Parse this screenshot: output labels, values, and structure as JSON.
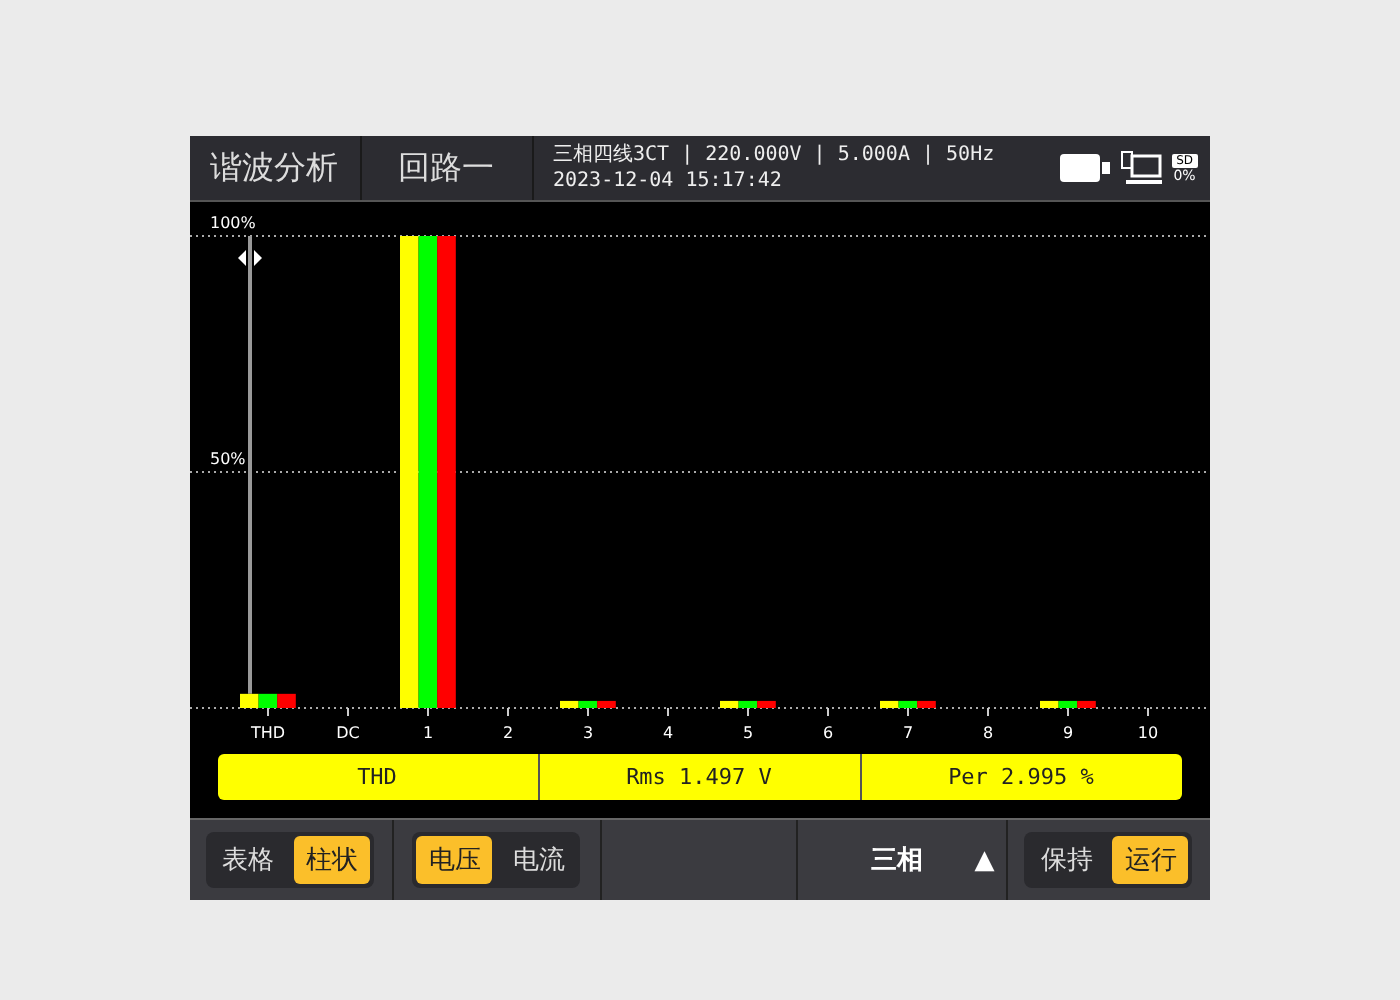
{
  "header": {
    "title": "谐波分析",
    "loop": "回路一",
    "info": "三相四线3CT | 220.000V | 5.000A | 50Hz",
    "datetime": "2023-12-04 15:17:42",
    "sd_label": "SD",
    "storage": "0%"
  },
  "chart": {
    "chart_data": {
      "type": "bar",
      "categories": [
        "THD",
        "DC",
        "1",
        "2",
        "3",
        "4",
        "5",
        "6",
        "7",
        "8",
        "9",
        "10"
      ],
      "ylim": [
        0,
        100
      ],
      "yticks": [
        {
          "value": 50,
          "label": "50%"
        },
        {
          "value": 100,
          "label": "100%"
        }
      ],
      "series": [
        {
          "color": "#ffff00",
          "values": [
            3,
            0,
            100,
            0,
            1.5,
            0,
            1.5,
            0,
            1.5,
            0,
            1.5,
            0
          ]
        },
        {
          "color": "#00ff00",
          "values": [
            3,
            0,
            100,
            0,
            1.5,
            0,
            1.5,
            0,
            1.5,
            0,
            1.5,
            0
          ]
        },
        {
          "color": "#ff0000",
          "values": [
            3,
            0,
            100,
            0,
            1.5,
            0,
            1.5,
            0,
            1.5,
            0,
            1.5,
            0
          ]
        }
      ]
    }
  },
  "info_bar": [
    "THD",
    "Rms 1.497 V",
    "Per 2.995 %"
  ],
  "toolbar": {
    "view_tabs": [
      {
        "label": "表格",
        "selected": false
      },
      {
        "label": "柱状",
        "selected": true
      }
    ],
    "signal_tabs": [
      {
        "label": "电压",
        "selected": true
      },
      {
        "label": "电流",
        "selected": false
      }
    ],
    "phase": {
      "label": "三相",
      "arrow": "▲"
    },
    "run_tabs": [
      {
        "label": "保持",
        "selected": false
      },
      {
        "label": "运行",
        "selected": true
      }
    ]
  }
}
